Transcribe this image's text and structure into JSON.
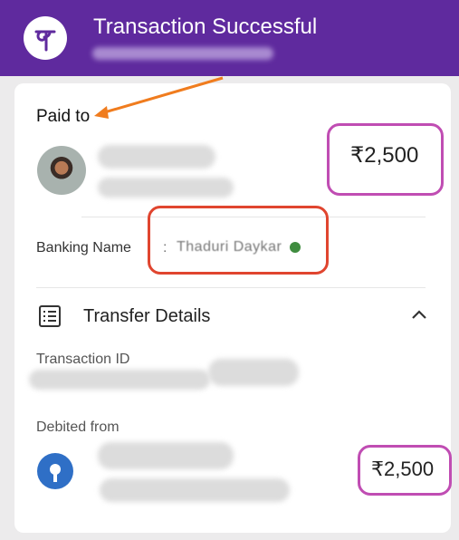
{
  "header": {
    "title": "Transaction Successful",
    "logo_glyph": "पे",
    "logo_icon": "phonepe-logo-icon",
    "bg_color": "#5f2a9e"
  },
  "paid_to": {
    "label": "Paid to",
    "amount": "₹2,500"
  },
  "banking": {
    "label": "Banking Name",
    "separator": ":",
    "name": "Thaduri Daykar",
    "verified_icon": "verified-shield-icon"
  },
  "transfer": {
    "title": "Transfer Details",
    "icon": "list-details-icon",
    "toggle_icon": "chevron-up-icon",
    "transaction_id_label": "Transaction ID",
    "debited_from_label": "Debited from",
    "debited_amount": "₹2,500",
    "bank_icon": "sbi-bank-icon"
  },
  "annotations": {
    "arrow_color": "#f07c1e",
    "highlight_amount_color": "#c04db3",
    "highlight_name_color": "#e0452f"
  }
}
